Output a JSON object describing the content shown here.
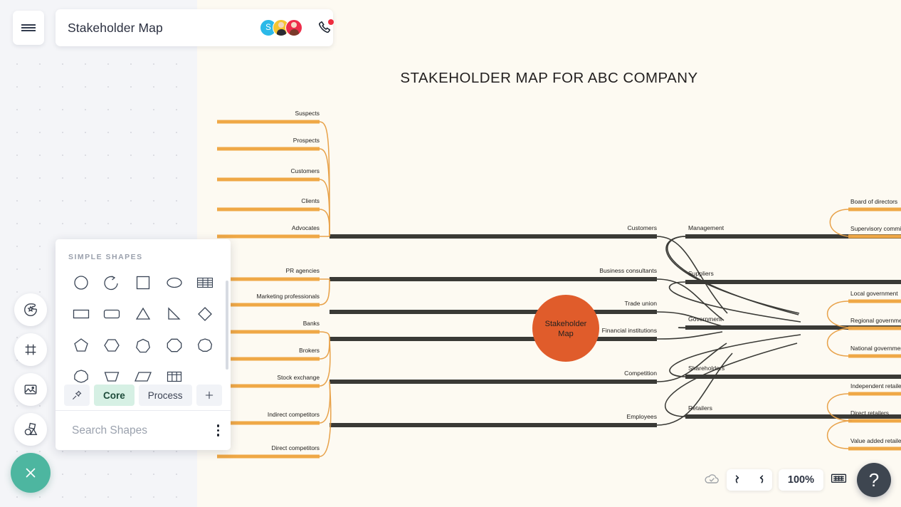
{
  "app": {
    "document_title": "Stakeholder Map",
    "hamburger_icon": "hamburger-menu-icon",
    "call_icon": "phone-call-icon",
    "collaborators": [
      {
        "name": "avatar-skype",
        "initial": "S",
        "color": "#2bb9e8"
      },
      {
        "name": "avatar-user1",
        "initial": "",
        "color": "#f5c431"
      },
      {
        "name": "avatar-user2",
        "initial": "",
        "color": "#ee2d4a"
      }
    ]
  },
  "tool_rail": {
    "items": [
      {
        "name": "theme-icon",
        "label": "Theme"
      },
      {
        "name": "frame-icon",
        "label": "Frame"
      },
      {
        "name": "image-icon",
        "label": "Image"
      },
      {
        "name": "shapes-icon",
        "label": "Shapes"
      }
    ],
    "close_label": "close-icon"
  },
  "shapes_panel": {
    "header": "SIMPLE SHAPES",
    "shapes": [
      "circle",
      "arc",
      "square",
      "ellipse",
      "table-striped",
      "rectangle",
      "rounded-rectangle",
      "triangle",
      "right-triangle",
      "diamond",
      "pentagon",
      "hexagon",
      "heptagon",
      "octagon",
      "nonagon",
      "decagon",
      "trapezoid",
      "parallelogram",
      "table-grid"
    ],
    "tabs": [
      {
        "name": "pin-tab",
        "label": "",
        "icon": "pin-icon",
        "active": false
      },
      {
        "name": "core-tab",
        "label": "Core",
        "icon": "",
        "active": true
      },
      {
        "name": "process-tab",
        "label": "Process",
        "icon": "",
        "active": false
      },
      {
        "name": "add-tab",
        "label": "",
        "icon": "plus-icon",
        "active": false
      }
    ],
    "search_placeholder": "Search Shapes",
    "search_value": "",
    "more_icon": "more-vertical-icon"
  },
  "canvas": {
    "title": "STAKEHOLDER MAP FOR ABC COMPANY",
    "center_node": {
      "line1": "Stakeholder",
      "line2": "Map",
      "color": "#e05c2b"
    }
  },
  "chart_data": {
    "type": "diagram",
    "diagram_kind": "mind-map",
    "title": "STAKEHOLDER MAP FOR ABC COMPANY",
    "center": "Stakeholder Map",
    "colors": {
      "center": "#e05c2b",
      "main_branch": "#3a3a36",
      "sub_branch": "#efa846",
      "canvas": "#fdfaf2"
    },
    "branches": [
      {
        "label": "Customers",
        "side": "left",
        "children": [
          "Suspects",
          "Prospects",
          "Customers",
          "Clients",
          "Advocates"
        ]
      },
      {
        "label": "Business consultants",
        "side": "left",
        "children": [
          "PR agencies",
          "Marketing professionals"
        ]
      },
      {
        "label": "Trade union",
        "side": "left",
        "children": []
      },
      {
        "label": "Financial institutions",
        "side": "left",
        "children": [
          "Banks",
          "Brokers",
          "Stock exchange"
        ]
      },
      {
        "label": "Competition",
        "side": "left",
        "children": [
          "Indirect competitors",
          "Direct competitors"
        ]
      },
      {
        "label": "Employees",
        "side": "left",
        "children": []
      },
      {
        "label": "Management",
        "side": "right",
        "children": [
          "Board of directors",
          "Supervisory committee"
        ]
      },
      {
        "label": "Suppliers",
        "side": "right",
        "children": []
      },
      {
        "label": "Government",
        "side": "right",
        "children": [
          "Local government",
          "Regional government",
          "National government"
        ]
      },
      {
        "label": "Shareholders",
        "side": "right",
        "children": []
      },
      {
        "label": "Retailers",
        "side": "right",
        "children": [
          "Independent retailers",
          "Direct retailers",
          "Value added retailers"
        ]
      }
    ]
  },
  "bottom_bar": {
    "cloud_icon": "cloud-saved-icon",
    "undo_icon": "undo-icon",
    "redo_icon": "redo-icon",
    "zoom_level": "100%",
    "keyboard_icon": "keyboard-shortcuts-icon",
    "help_label": "?"
  }
}
